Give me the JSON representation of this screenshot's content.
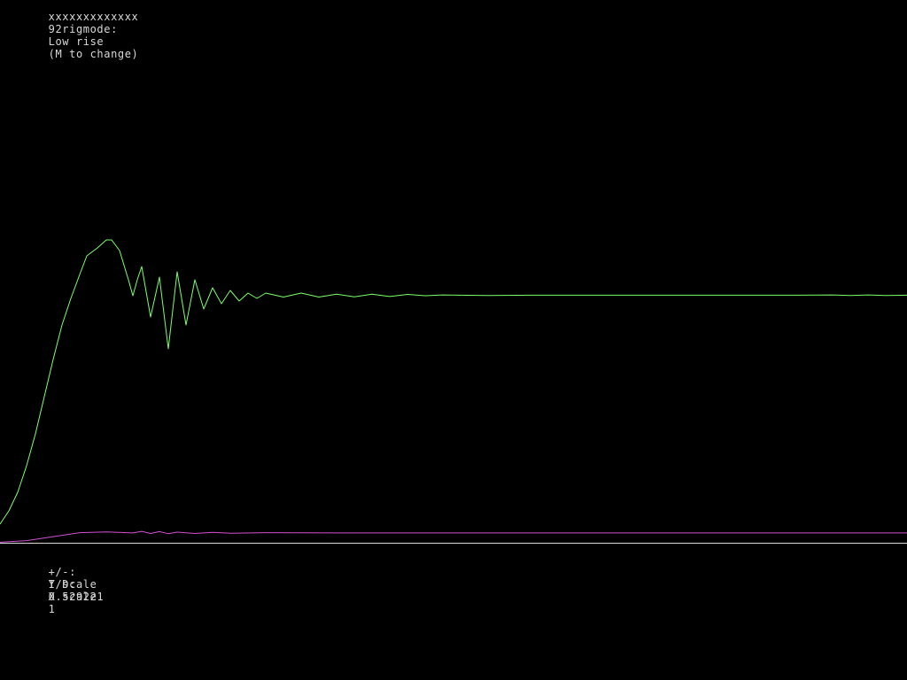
{
  "header": {
    "obfuscated_name": "xxxxxxxxxxxxx",
    "rig": "92rig",
    "mode_label": "mode:",
    "mode_value": "Low rise",
    "mode_hint": "(M to change)"
  },
  "controls": {
    "y_scale_keys": "+/-:",
    "y_scale_label": "Y scale",
    "y_scale_value": "0.529221",
    "x_scale_keys": "I/D:",
    "x_scale_label": "X scale",
    "x_scale_value": "1"
  },
  "colors": {
    "background": "#000000",
    "text": "#d8d8d8",
    "response_trace": "#7cff6a",
    "effort_trace": "#d050d0",
    "baseline": "#d8d8d8"
  },
  "chart_data": {
    "type": "line",
    "title": "",
    "xlabel": "",
    "ylabel": "",
    "grid": false,
    "legend": "none",
    "x_range": [
      0,
      1024
    ],
    "y_range": [
      -40,
      100
    ],
    "baseline_y": 0,
    "series": [
      {
        "id": "response",
        "color": "#7cff6a",
        "points": [
          [
            0,
            7
          ],
          [
            10,
            12
          ],
          [
            20,
            19
          ],
          [
            30,
            29
          ],
          [
            40,
            41
          ],
          [
            50,
            55
          ],
          [
            60,
            69
          ],
          [
            70,
            82
          ],
          [
            80,
            92
          ],
          [
            90,
            101
          ],
          [
            98,
            108
          ],
          [
            110,
            111
          ],
          [
            120,
            114
          ],
          [
            126,
            114
          ],
          [
            135,
            110
          ],
          [
            145,
            99
          ],
          [
            150,
            93
          ],
          [
            155,
            99
          ],
          [
            160,
            104
          ],
          [
            170,
            85
          ],
          [
            180,
            100
          ],
          [
            190,
            73
          ],
          [
            200,
            102
          ],
          [
            210,
            82
          ],
          [
            220,
            99
          ],
          [
            230,
            88
          ],
          [
            240,
            96
          ],
          [
            250,
            90
          ],
          [
            260,
            95
          ],
          [
            270,
            91
          ],
          [
            280,
            94
          ],
          [
            290,
            92
          ],
          [
            300,
            94
          ],
          [
            320,
            92.5
          ],
          [
            340,
            94
          ],
          [
            360,
            92.5
          ],
          [
            380,
            93.6
          ],
          [
            400,
            92.6
          ],
          [
            420,
            93.6
          ],
          [
            440,
            92.7
          ],
          [
            460,
            93.5
          ],
          [
            480,
            93
          ],
          [
            500,
            93.3
          ],
          [
            550,
            93.1
          ],
          [
            600,
            93.2
          ],
          [
            700,
            93.2
          ],
          [
            800,
            93.2
          ],
          [
            900,
            93.2
          ],
          [
            940,
            93.3
          ],
          [
            960,
            93.1
          ],
          [
            980,
            93.3
          ],
          [
            1000,
            93.1
          ],
          [
            1024,
            93.2
          ]
        ]
      },
      {
        "id": "control-effort",
        "color": "#d050d0",
        "points": [
          [
            0,
            0.2
          ],
          [
            30,
            0.8
          ],
          [
            60,
            2.3
          ],
          [
            90,
            3.8
          ],
          [
            120,
            4.1
          ],
          [
            150,
            3.7
          ],
          [
            160,
            4.3
          ],
          [
            170,
            3.5
          ],
          [
            180,
            4.2
          ],
          [
            190,
            3.4
          ],
          [
            200,
            4.0
          ],
          [
            220,
            3.5
          ],
          [
            240,
            3.9
          ],
          [
            260,
            3.6
          ],
          [
            300,
            3.8
          ],
          [
            400,
            3.7
          ],
          [
            600,
            3.7
          ],
          [
            800,
            3.7
          ],
          [
            1024,
            3.7
          ]
        ]
      }
    ]
  }
}
